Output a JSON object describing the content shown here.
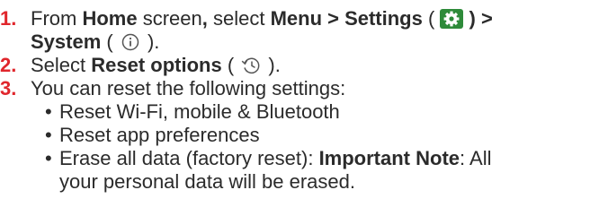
{
  "steps": [
    {
      "number": "1.",
      "text_a": "From ",
      "home": "Home",
      "text_b": " screen",
      "comma": ",",
      "text_c": " select ",
      "menu_settings": "Menu > Settings",
      "paren_open_1": " ( ",
      "settings_icon": "settings-gear-icon",
      "paren_close_1": " ) >",
      "system": "System",
      "paren_open_2": " ( ",
      "system_icon": "info-circle-icon",
      "paren_close_2": " )."
    },
    {
      "number": "2.",
      "text_a": "Select ",
      "reset_options": "Reset options",
      "paren_open": " ( ",
      "reset_icon": "history-clock-icon",
      "paren_close": " )."
    },
    {
      "number": "3.",
      "text": "You can reset the following settings:"
    }
  ],
  "bullets": [
    {
      "dot": "•",
      "text": "Reset Wi-Fi, mobile & Bluetooth"
    },
    {
      "dot": "•",
      "text": "Reset app preferences"
    },
    {
      "dot": "•",
      "text_a": "Erase all data (factory reset): ",
      "important": "Important Note",
      "text_b": ": All",
      "text_c": "your personal data will be erased."
    }
  ],
  "colors": {
    "step_number": "#e0262c",
    "settings_icon_bg": "#2e8b3a",
    "text": "#2b2b2b"
  }
}
